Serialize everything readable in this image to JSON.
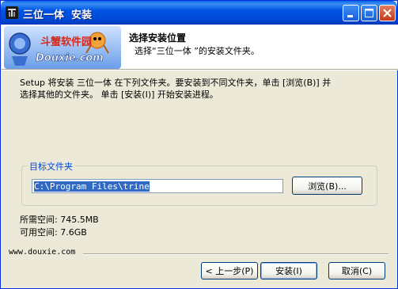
{
  "window": {
    "title": "三位一体  安装"
  },
  "header": {
    "title": "选择安装位置",
    "subtitle": "选择“三位一体 ”的安装文件夹。",
    "logo_text_top": "斗蟹软件园",
    "logo_text_bottom": "Douxie.com"
  },
  "intro": {
    "line1": "Setup 将安装 三位一体  在下列文件夹。要安装到不同文件夹，单击 [浏览(B)] 并",
    "line2": "选择其他的文件夹。 单击 [安装(I)] 开始安装进程。"
  },
  "target_folder": {
    "group_label": "目标文件夹",
    "path_value": "C:\\Program Files\\trine",
    "browse_label": "浏览(B)..."
  },
  "space": {
    "required": "所需空间: 745.5MB",
    "available": "可用空间: 7.6GB"
  },
  "footer": {
    "link": "www.douxie.com",
    "back_label": "< 上一步(P)",
    "install_label": "安装(I)",
    "cancel_label": "取消(C)"
  }
}
